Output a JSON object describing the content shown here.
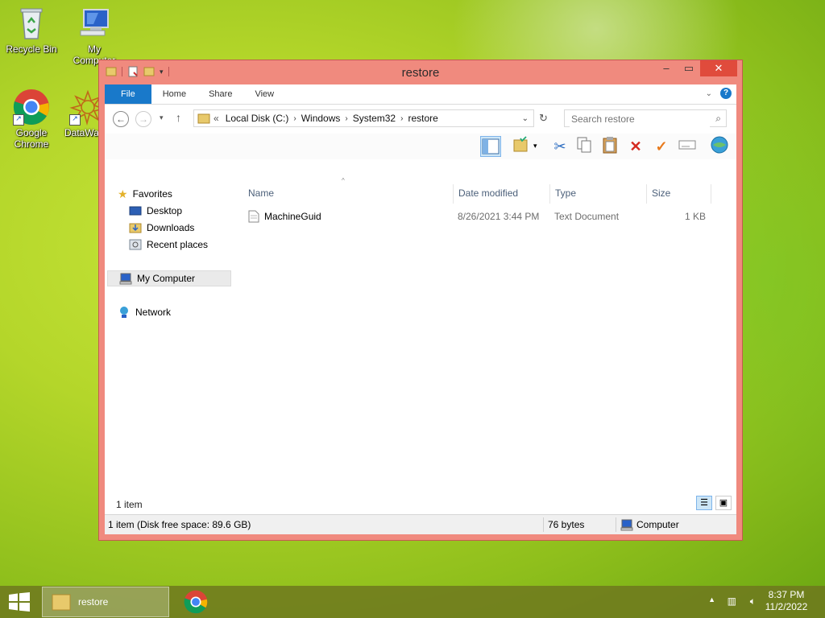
{
  "desktop": {
    "icons": [
      {
        "label": "Recycle Bin"
      },
      {
        "label": "My Computer"
      },
      {
        "label": "Google Chrome"
      },
      {
        "label": "DataWa"
      }
    ]
  },
  "window": {
    "title": "restore",
    "ribbon_tabs": [
      "File",
      "Home",
      "Share",
      "View"
    ],
    "address": {
      "prefix": "«",
      "crumbs": [
        "Local Disk (C:)",
        "Windows",
        "System32",
        "restore"
      ]
    },
    "search": {
      "placeholder": "Search restore"
    },
    "nav": {
      "favorites": "Favorites",
      "desktop": "Desktop",
      "downloads": "Downloads",
      "recent": "Recent places",
      "computer": "My Computer",
      "network": "Network"
    },
    "columns": {
      "name": "Name",
      "date": "Date modified",
      "type": "Type",
      "size": "Size"
    },
    "files": [
      {
        "name": "MachineGuid",
        "date": "8/26/2021 3:44 PM",
        "type": "Text Document",
        "size": "1 KB"
      }
    ],
    "item_count": "1 item",
    "statusbar": {
      "left": "1 item (Disk free space: 89.6 GB)",
      "middle": "76 bytes",
      "right": "Computer"
    }
  },
  "taskbar": {
    "task_label": "restore",
    "time": "8:37 PM",
    "date": "11/2/2022"
  },
  "colors": {
    "window_frame": "#f08a7e",
    "close_button": "#e04b3c",
    "file_tab": "#1979ca"
  }
}
